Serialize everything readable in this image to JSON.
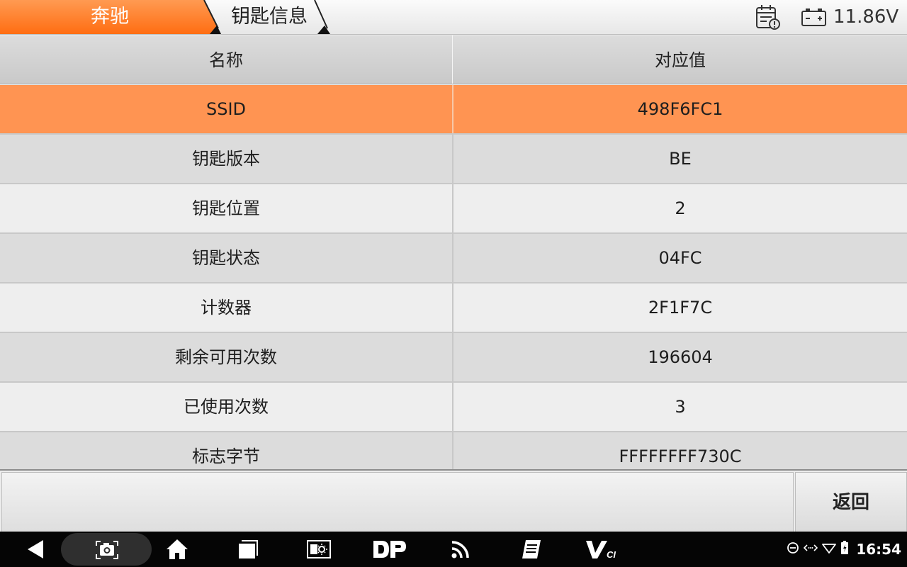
{
  "header": {
    "breadcrumbs": [
      {
        "label": "奔驰"
      },
      {
        "label": "钥匙信息"
      }
    ],
    "report_icon": "calendar-alert-icon",
    "battery_icon": "car-battery-icon",
    "voltage": "11.86V",
    "colors": {
      "active_tab": "#ff7a29",
      "selected_row": "#ff9452"
    }
  },
  "table": {
    "columns": [
      "名称",
      "对应值"
    ],
    "rows": [
      {
        "name": "SSID",
        "value": "498F6FC1",
        "selected": true
      },
      {
        "name": "钥匙版本",
        "value": "BE"
      },
      {
        "name": "钥匙位置",
        "value": "2"
      },
      {
        "name": "钥匙状态",
        "value": "04FC"
      },
      {
        "name": "计数器",
        "value": "2F1F7C"
      },
      {
        "name": "剩余可用次数",
        "value": "196604"
      },
      {
        "name": "已使用次数",
        "value": "3"
      },
      {
        "name": "标志字节",
        "value": "FFFFFFFF730C"
      }
    ]
  },
  "actions": {
    "back_label": "返回"
  },
  "navbar": {
    "icons": [
      "back-icon",
      "screenshot-icon",
      "home-icon",
      "recent-apps-icon",
      "brightness-icon",
      "dp-icon",
      "rss-icon",
      "notes-icon",
      "vci-icon"
    ],
    "dp_text": "DP",
    "vci_text": "V",
    "vci_sub": "CI",
    "status_icons": [
      "dnd-icon",
      "data-transfer-icon",
      "wifi-icon",
      "battery-icon"
    ],
    "clock": "16:54"
  }
}
